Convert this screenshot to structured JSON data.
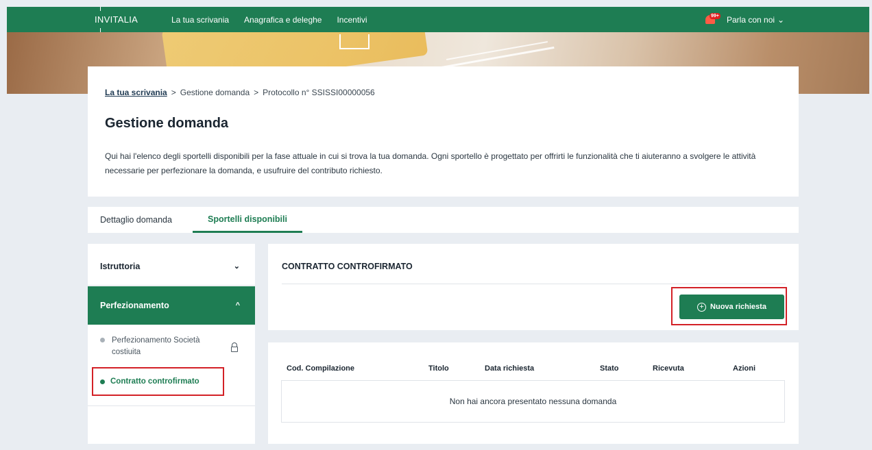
{
  "header": {
    "brand": "INVITALIA",
    "nav": [
      "La tua scrivania",
      "Anagrafica e deleghe",
      "Incentivi"
    ],
    "notification_badge": "99+",
    "contact_label": "Parla con noi",
    "contact_chevron": "⌄"
  },
  "breadcrumb": {
    "home": "La tua scrivania",
    "sep": ">",
    "current_section": "Gestione domanda",
    "protocol": "Protocollo n° SSISSI00000056"
  },
  "page": {
    "title": "Gestione domanda",
    "description": "Qui hai l'elenco degli sportelli disponibili per la fase attuale in cui si trova la tua domanda. Ogni sportello è progettato per offrirti le funzionalità che ti aiuteranno a svolgere le attività necessarie per perfezionare la domanda, e usufruire del contributo richiesto."
  },
  "tabs": [
    {
      "label": "Dettaglio domanda",
      "active": false
    },
    {
      "label": "Sportelli disponibili",
      "active": true
    }
  ],
  "sidebar": {
    "sections": [
      {
        "label": "Istruttoria",
        "expanded": false,
        "chevron": "⌄"
      },
      {
        "label": "Perfezionamento",
        "expanded": true,
        "chevron": "^"
      }
    ],
    "items": [
      {
        "label": "Perfezionamento Società costiuita",
        "locked": true,
        "icon": "lock-icon"
      },
      {
        "label": "Contratto controfirmato",
        "active": true
      }
    ]
  },
  "contract": {
    "title": "CONTRATTO CONTROFIRMATO",
    "new_request_label": "Nuova richiesta",
    "new_request_icon": "+"
  },
  "table": {
    "columns": [
      "Cod. Compilazione",
      "Titolo",
      "Data richiesta",
      "Stato",
      "Ricevuta",
      "Azioni"
    ],
    "empty_message": "Non hai ancora presentato nessuna domanda"
  },
  "colors": {
    "primary": "#1e7d53",
    "highlight": "#d32026",
    "background": "#e9edf2"
  }
}
